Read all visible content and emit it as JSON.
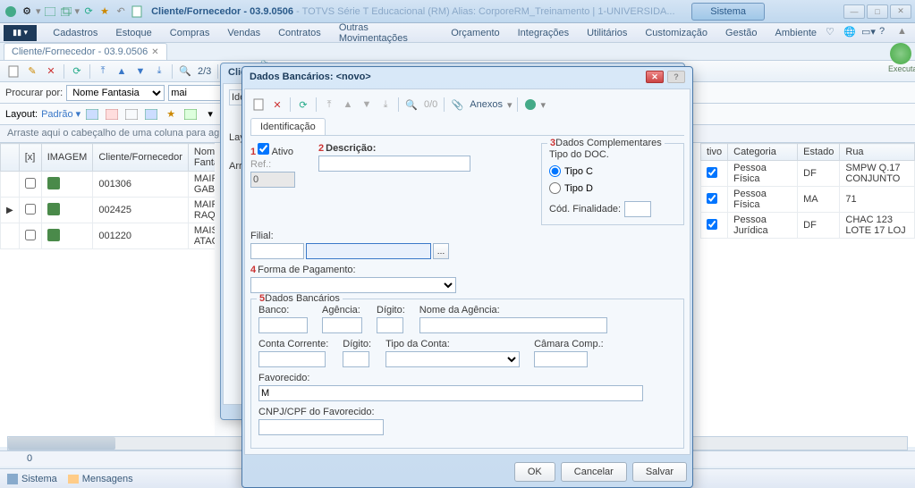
{
  "titlebar": {
    "title": "Cliente/Fornecedor - 03.9.0506",
    "suffix": " - TOTVS Série T Educacional (RM) Alias: CorporeRM_Treinamento | 1-UNIVERSIDA...",
    "sistema": "Sistema"
  },
  "menubar": {
    "items": [
      "Cadastros",
      "Estoque",
      "Compras",
      "Vendas",
      "Contratos",
      "Outras Movimentações",
      "Orçamento",
      "Integrações",
      "Utilitários",
      "Customização",
      "Gestão",
      "Ambiente"
    ]
  },
  "tab": {
    "label": "Cliente/Fornecedor - 03.9.0506"
  },
  "toolbar": {
    "page": "2/3"
  },
  "search": {
    "label": "Procurar por:",
    "field": "Nome Fantasia",
    "value": "mai"
  },
  "layoutbar": {
    "label": "Layout:",
    "value": "Padrão"
  },
  "group_hint": "Arraste aqui o cabeçalho de uma coluna para agrupar",
  "grid": {
    "left_headers": [
      "[x]",
      "IMAGEM",
      "Cliente/Fornecedor",
      "Nome Fantasia"
    ],
    "right_headers": [
      "tivo",
      "Categoria",
      "Estado",
      "Rua"
    ],
    "rows": [
      {
        "code": "001306",
        "name": "MAIRA GABRIEL",
        "cat": "Pessoa Física",
        "estado": "DF",
        "rua": "SMPW Q.17 CONJUNTO"
      },
      {
        "code": "002425",
        "name": "MAIRA RAQUEL",
        "cat": "Pessoa Física",
        "estado": "MA",
        "rua": "71"
      },
      {
        "code": "001220",
        "name": "MAIS ATACADIS",
        "cat": "Pessoa Jurídica",
        "estado": "DF",
        "rua": "CHAC 123 LOTE 17 LOJ"
      }
    ]
  },
  "status_count": "0",
  "bottombar": {
    "sistema": "Sistema",
    "mensagens": "Mensagens"
  },
  "executar": "Executar",
  "modal_behind": {
    "title": "Cliente",
    "tab": "Ide",
    "lay": "Lay",
    "arr": "Arr"
  },
  "modal": {
    "title": "Dados Bancários: <novo>",
    "toolbar_page": "0/0",
    "toolbar_anexos": "Anexos",
    "tab": "Identificação",
    "fields": {
      "ativo_num": "1",
      "ativo": "Ativo",
      "ref": "Ref.:",
      "ref_val": "0",
      "desc_num": "2",
      "desc": "Descrição:",
      "comp_num": "3",
      "comp": "Dados Complementares",
      "tipodoc": "Tipo do DOC.",
      "tipo_c": "Tipo C",
      "tipo_d": "Tipo D",
      "cod_fin": "Cód. Finalidade:",
      "filial": "Filial:",
      "forma_num": "4",
      "forma": "Forma de Pagamento:",
      "banc_num": "5",
      "banc": "Dados Bancários",
      "banco": "Banco:",
      "agencia": "Agência:",
      "digito": "Dígito:",
      "nome_ag": "Nome da Agência:",
      "cc": "Conta Corrente:",
      "digito2": "Dígito:",
      "tipo_conta": "Tipo da Conta:",
      "camara": "Câmara Comp.:",
      "favorecido": "Favorecido:",
      "fav_val": "M",
      "cnpj": "CNPJ/CPF do Favorecido:"
    },
    "buttons": {
      "ok": "OK",
      "cancelar": "Cancelar",
      "salvar": "Salvar"
    }
  }
}
